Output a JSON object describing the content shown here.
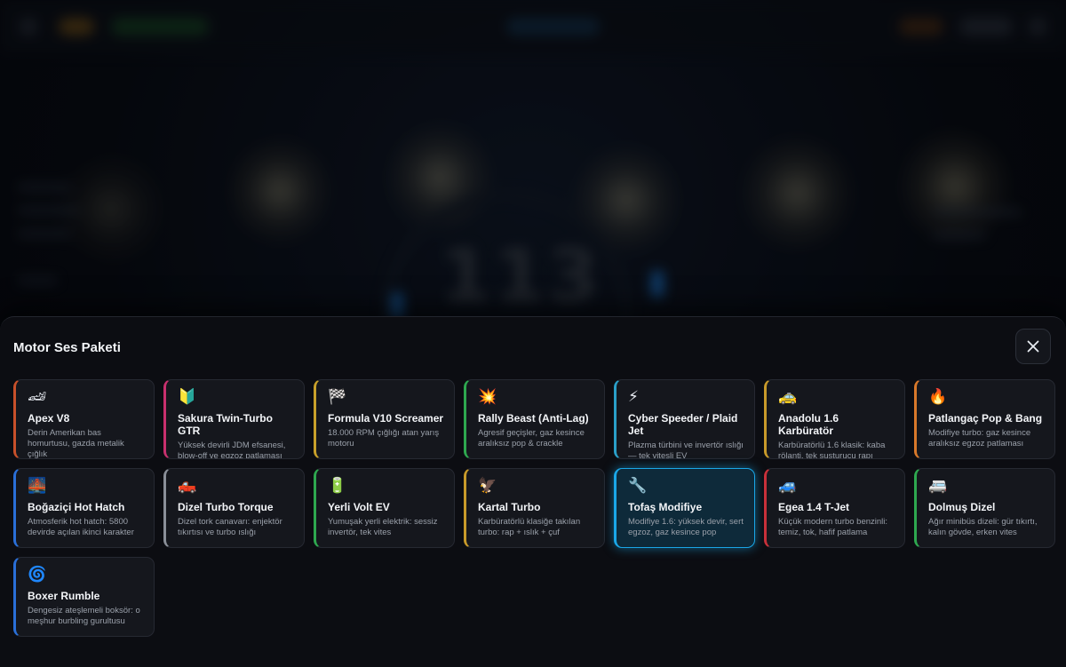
{
  "background": {
    "speed_readout": "113"
  },
  "modal": {
    "title": "Motor Ses Paketi",
    "close_label": "×"
  },
  "sound_packs": [
    {
      "name": "Apex V8",
      "description": "Derin Amerikan bas homurtusu, gazda metalik çığlık",
      "icon": "race-car-icon",
      "glyph": "🏎",
      "accent": "#c8502a",
      "selected": false
    },
    {
      "name": "Sakura Twin-Turbo GTR",
      "description": "Yüksek devirli JDM efsanesi, blow-off ve egzoz patlaması",
      "icon": "beginner-badge-icon",
      "glyph": "🔰",
      "accent": "#c8306e",
      "selected": false
    },
    {
      "name": "Formula V10 Screamer",
      "description": "18.000 RPM çığlığı atan yarış motoru",
      "icon": "checkered-flag-icon",
      "glyph": "🏁",
      "accent": "#c8a02a",
      "selected": false
    },
    {
      "name": "Rally Beast (Anti-Lag)",
      "description": "Agresif geçişler, gaz kesince aralıksız pop & crackle",
      "icon": "explosion-icon",
      "glyph": "💥",
      "accent": "#2ea84f",
      "selected": false
    },
    {
      "name": "Cyber Speeder / Plaid Jet",
      "description": "Plazma türbini ve invertör ıslığı — tek vitesli EV",
      "icon": "lightning-icon",
      "glyph": "⚡",
      "accent": "#2a9fc8",
      "selected": false
    },
    {
      "name": "Anadolu 1.6 Karbüratör",
      "description": "Karbüratörlü 1.6 klasik: kaba rölanti, tek susturucu rapı",
      "icon": "taxi-icon",
      "glyph": "🚕",
      "accent": "#c89a2a",
      "selected": false
    },
    {
      "name": "Patlangaç Pop & Bang",
      "description": "Modifiye turbo: gaz kesince aralıksız egzoz patlaması",
      "icon": "fire-icon",
      "glyph": "🔥",
      "accent": "#d8782a",
      "selected": false
    },
    {
      "name": "Boğaziçi Hot Hatch",
      "description": "Atmosferik hot hatch: 5800 devirde açılan ikinci karakter",
      "icon": "cityscape-icon",
      "glyph": "🌉",
      "accent": "#2a6fd8",
      "selected": false
    },
    {
      "name": "Dizel Turbo Torque",
      "description": "Dizel tork canavarı: enjektör tıkırtısı ve turbo ıslığı",
      "icon": "pickup-truck-icon",
      "glyph": "🛻",
      "accent": "#8a8f98",
      "selected": false
    },
    {
      "name": "Yerli Volt EV",
      "description": "Yumuşak yerli elektrik: sessiz invertör, tek vites",
      "icon": "battery-icon",
      "glyph": "🔋",
      "accent": "#2ea84f",
      "selected": false
    },
    {
      "name": "Kartal Turbo",
      "description": "Karbüratörlü klasiğe takılan turbo: rap + ıslık + çuf",
      "icon": "eagle-icon",
      "glyph": "🦅",
      "accent": "#c89a2a",
      "selected": false
    },
    {
      "name": "Tofaş Modifiye",
      "description": "Modifiye 1.6: yüksek devir, sert egzoz, gaz kesince pop",
      "icon": "wrench-icon",
      "glyph": "🔧",
      "accent": "#1aa7e8",
      "selected": true
    },
    {
      "name": "Egea 1.4 T-Jet",
      "description": "Küçük modern turbo benzinli: temiz, tok, hafif patlama",
      "icon": "car-icon",
      "glyph": "🚙",
      "accent": "#c8303a",
      "selected": false
    },
    {
      "name": "Dolmuş Dizel",
      "description": "Ağır minibüs dizeli: gür tıkırtı, kalın gövde, erken vites",
      "icon": "minibus-icon",
      "glyph": "🚐",
      "accent": "#2ea84f",
      "selected": false
    },
    {
      "name": "Boxer Rumble",
      "description": "Dengesiz ateşlemeli boksör: o meşhur burbling gurultusu",
      "icon": "cyclone-icon",
      "glyph": "🌀",
      "accent": "#2a6fd8",
      "selected": false
    }
  ]
}
